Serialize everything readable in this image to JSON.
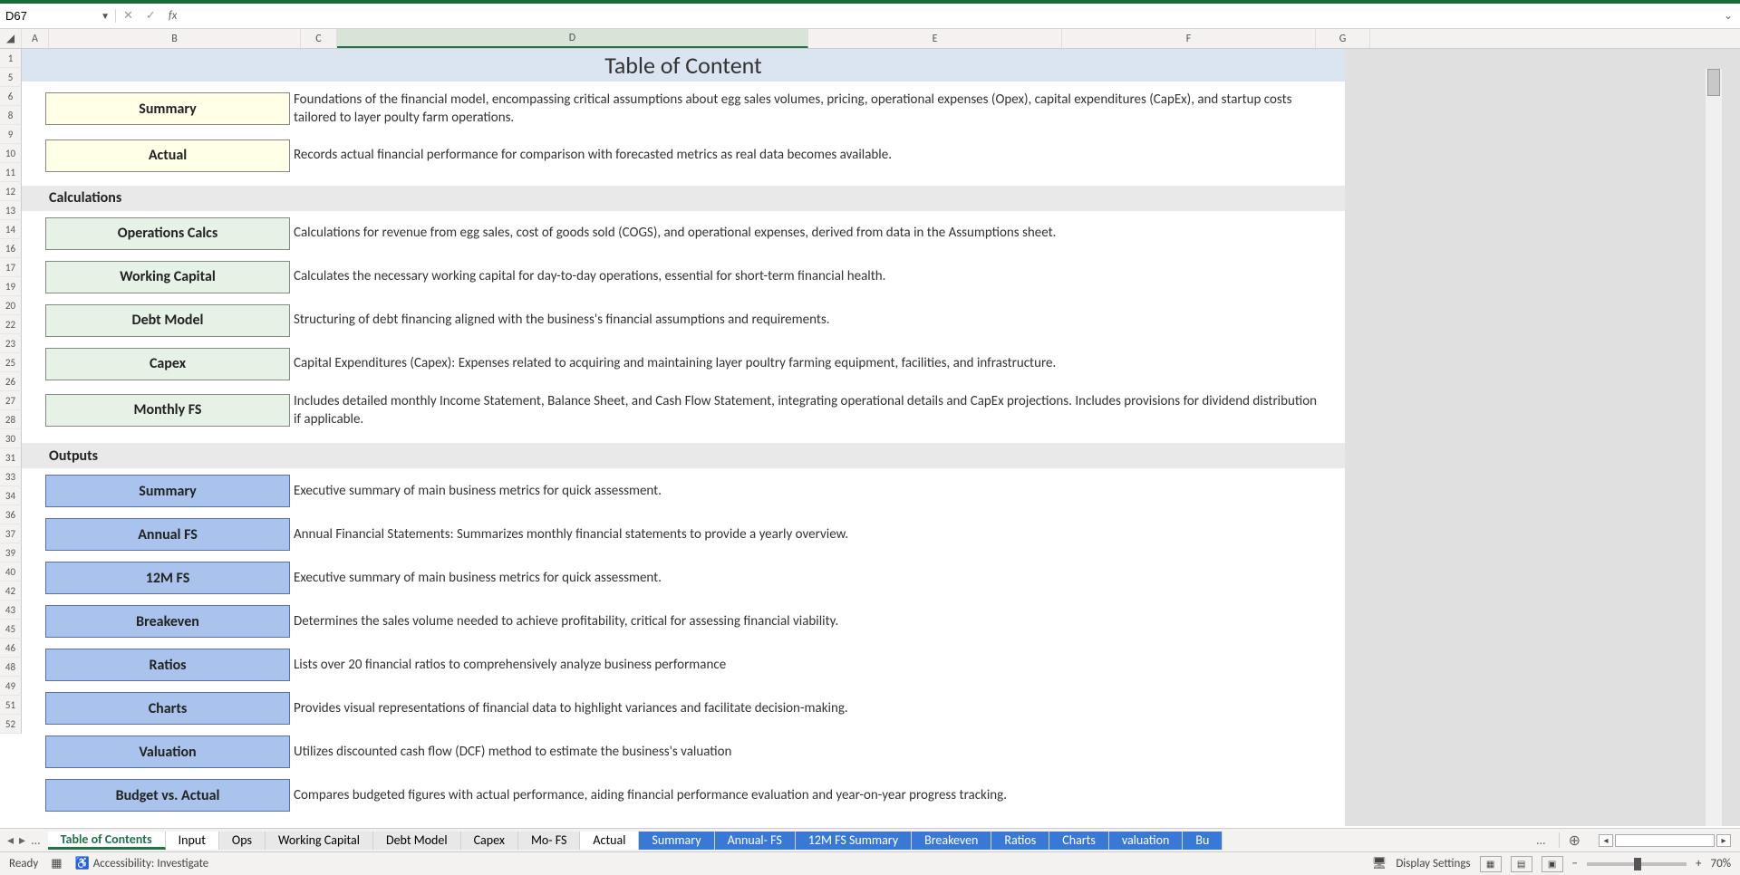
{
  "formula_bar": {
    "name_box": "D67",
    "formula": ""
  },
  "columns": [
    "A",
    "B",
    "C",
    "D",
    "E",
    "F",
    "G"
  ],
  "row_numbers": [
    "1",
    "5",
    "6",
    "8",
    "9",
    "10",
    "11",
    "12",
    "13",
    "14",
    "16",
    "17",
    "19",
    "20",
    "22",
    "23",
    "25",
    "26",
    "27",
    "28",
    "30",
    "31",
    "33",
    "34",
    "36",
    "37",
    "39",
    "40",
    "42",
    "43",
    "45",
    "46",
    "48",
    "49",
    "51",
    "52"
  ],
  "title": "Table of Content",
  "sections": {
    "inputs": [
      {
        "label": "Summary",
        "desc": "Foundations of the financial model, encompassing critical assumptions about egg sales volumes, pricing, operational expenses (Opex), capital expenditures (CapEx), and startup costs tailored to layer poulty farm operations.",
        "style": "yellow"
      },
      {
        "label": "Actual",
        "desc": "Records actual financial performance for comparison with forecasted metrics as real data becomes available.",
        "style": "yellow"
      }
    ],
    "calc_header": "Calculations",
    "calculations": [
      {
        "label": "Operations Calcs",
        "desc": "Calculations for revenue from egg sales, cost of goods sold (COGS), and operational expenses, derived from data in the Assumptions sheet.",
        "style": "green"
      },
      {
        "label": "Working Capital",
        "desc": "Calculates the necessary working capital for day-to-day operations, essential for short-term financial health.",
        "style": "green"
      },
      {
        "label": "Debt Model",
        "desc": "Structuring of debt financing aligned with the business's financial assumptions and requirements.",
        "style": "green"
      },
      {
        "label": "Capex",
        "desc": "Capital Expenditures (Capex): Expenses related to acquiring and maintaining layer poultry farming equipment, facilities, and infrastructure.",
        "style": "green"
      },
      {
        "label": "Monthly FS",
        "desc": "Includes detailed monthly Income Statement, Balance Sheet, and Cash Flow Statement, integrating operational details and CapEx projections. Includes provisions for dividend distribution if applicable.",
        "style": "green"
      }
    ],
    "out_header": "Outputs",
    "outputs": [
      {
        "label": "Summary",
        "desc": "Executive summary of main business metrics for quick assessment.",
        "style": "blue"
      },
      {
        "label": "Annual FS",
        "desc": "Annual Financial Statements: Summarizes monthly financial statements to provide a yearly overview.",
        "style": "blue"
      },
      {
        "label": "12M FS",
        "desc": "Executive summary of main business metrics for quick assessment.",
        "style": "blue"
      },
      {
        "label": "Breakeven",
        "desc": "Determines the sales volume needed to achieve profitability, critical for assessing financial viability.",
        "style": "blue"
      },
      {
        "label": "Ratios",
        "desc": "Lists over 20 financial ratios to comprehensively analyze business performance",
        "style": "blue"
      },
      {
        "label": "Charts",
        "desc": "Provides visual representations of financial data to highlight variances and facilitate decision-making.",
        "style": "blue"
      },
      {
        "label": "Valuation",
        "desc": "Utilizes discounted cash flow (DCF) method to estimate the business's valuation",
        "style": "blue"
      },
      {
        "label": "Budget vs. Actual",
        "desc": "Compares budgeted figures with actual performance, aiding financial performance evaluation and year-on-year progress tracking.",
        "style": "blue"
      }
    ]
  },
  "tabs": {
    "nav_first": "◂",
    "nav_prev": "▸",
    "ellipsis": "...",
    "list": [
      {
        "label": "Table of Contents",
        "class": "active"
      },
      {
        "label": "Input",
        "class": "yellow"
      },
      {
        "label": "Ops",
        "class": "gray"
      },
      {
        "label": "Working Capital",
        "class": "gray"
      },
      {
        "label": "Debt Model",
        "class": "gray"
      },
      {
        "label": "Capex",
        "class": "gray"
      },
      {
        "label": "Mo- FS",
        "class": "gray"
      },
      {
        "label": "Actual",
        "class": "yellow"
      },
      {
        "label": "Summary",
        "class": "blue"
      },
      {
        "label": "Annual- FS",
        "class": "blue"
      },
      {
        "label": "12M FS Summary",
        "class": "blue"
      },
      {
        "label": "Breakeven",
        "class": "blue"
      },
      {
        "label": "Ratios",
        "class": "blue"
      },
      {
        "label": "Charts",
        "class": "blue"
      },
      {
        "label": "valuation",
        "class": "blue"
      },
      {
        "label": "Bu",
        "class": "blue"
      }
    ],
    "more": "..."
  },
  "status": {
    "ready": "Ready",
    "accessibility": "Accessibility: Investigate",
    "display_settings": "Display Settings",
    "zoom": "70%"
  }
}
